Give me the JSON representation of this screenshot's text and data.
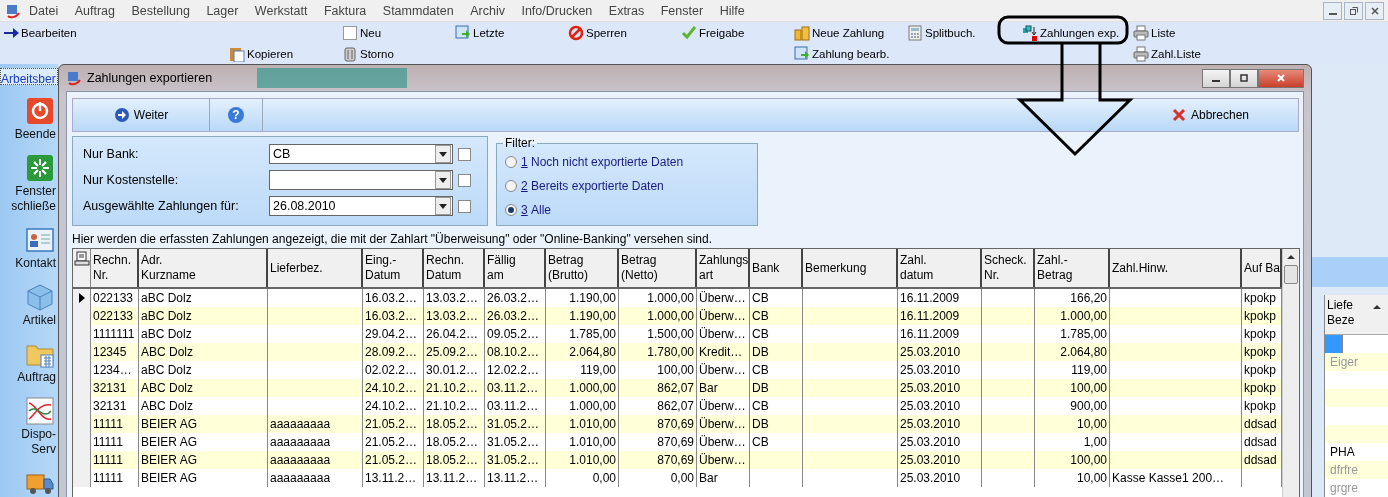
{
  "menubar": {
    "items": [
      "Datei",
      "Auftrag",
      "Bestellung",
      "Lager",
      "Werkstatt",
      "Faktura",
      "Stammdaten",
      "Archiv",
      "Info/Drucken",
      "Extras",
      "Fenster",
      "Hilfe"
    ]
  },
  "toolbar": {
    "columns": [
      {
        "top": {
          "label": "Bearbeiten",
          "highlighted": false
        }
      },
      {},
      {
        "bottom": {
          "label": "Kopieren",
          "highlighted": false
        }
      },
      {
        "top": {
          "label": "Neu",
          "highlighted": false
        },
        "bottom": {
          "label": "Storno",
          "highlighted": false
        }
      },
      {
        "top": {
          "label": "Letzte",
          "highlighted": false
        }
      },
      {
        "top": {
          "label": "Sperren",
          "highlighted": false
        }
      },
      {
        "top": {
          "label": "Freigabe",
          "highlighted": false
        }
      },
      {
        "top": {
          "label": "Neue Zahlung",
          "highlighted": false
        },
        "bottom": {
          "label": "Zahlung bearb.",
          "highlighted": false
        }
      },
      {
        "top": {
          "label": "Splitbuch.",
          "highlighted": false
        }
      },
      {
        "top": {
          "label": "Zahlungen exp.",
          "highlighted": true
        }
      },
      {
        "top": {
          "label": "Liste",
          "highlighted": false
        },
        "bottom": {
          "label": "Zahl.Liste",
          "highlighted": false
        }
      }
    ]
  },
  "sidebar": {
    "tab": "Arbeitsber",
    "items": [
      {
        "label": "Beende"
      },
      {
        "label": "Fenster schließe"
      },
      {
        "label": "Kontakt"
      },
      {
        "label": "Artikel"
      },
      {
        "label": "Auftrag"
      },
      {
        "label": "Dispo-Serv"
      }
    ]
  },
  "background_panel": {
    "header": "Liefe Beze",
    "rows": [
      {
        "selected": true
      },
      {
        "text": "Eiger",
        "selected": false,
        "dim": true
      },
      {
        "selected": false
      },
      {
        "selected": false
      },
      {
        "selected": false
      },
      {
        "selected": false
      },
      {
        "text": "PHA",
        "selected": false,
        "dim": false
      },
      {
        "text": "dfrfre",
        "selected": false,
        "dim": true
      },
      {
        "text": "grgre",
        "selected": false,
        "dim": true
      }
    ]
  },
  "dialog": {
    "title": "Zahlungen exportieren",
    "toolbar": {
      "next": "Weiter",
      "help": "?",
      "cancel": "Abbrechen"
    },
    "filters": [
      {
        "label": "Nur Bank:",
        "value": "CB",
        "checked": false
      },
      {
        "label": "Nur Kostenstelle:",
        "checked": false
      },
      {
        "label": "Ausgewählte Zahlungen für:",
        "value": "26.08.2010",
        "checked": false
      }
    ],
    "filter_group": {
      "legend": "Filter:",
      "options": [
        {
          "shortcut": "1",
          "label": "Noch nicht exportierte Daten",
          "selected": false
        },
        {
          "shortcut": "2",
          "label": "Bereits exportierte Daten",
          "selected": false
        },
        {
          "shortcut": "3",
          "label": "Alle",
          "selected": true
        }
      ]
    },
    "info": "Hier werden die erfassten Zahlungen angezeigt, die mit der Zahlart \"Überweisung\" oder \"Online-Banking\" versehen sind.",
    "table": {
      "columns": [
        {
          "lines": [
            "Rechn.",
            "Nr."
          ]
        },
        {
          "lines": [
            "Adr.",
            "Kurzname"
          ]
        },
        {
          "lines": [
            "Lieferbez."
          ]
        },
        {
          "lines": [
            "Eing.-",
            "Datum"
          ]
        },
        {
          "lines": [
            "Rechn.",
            "Datum"
          ]
        },
        {
          "lines": [
            "Fällig",
            "am"
          ]
        },
        {
          "lines": [
            "Betrag",
            "(Brutto)"
          ],
          "numeric": true
        },
        {
          "lines": [
            "Betrag",
            "(Netto)"
          ],
          "numeric": true
        },
        {
          "lines": [
            "Zahlungs",
            "art"
          ]
        },
        {
          "lines": [
            "Bank"
          ]
        },
        {
          "lines": [
            "Bemerkung"
          ]
        },
        {
          "lines": [
            "Zahl.",
            "datum"
          ]
        },
        {
          "lines": [
            "Scheck.",
            "Nr."
          ]
        },
        {
          "lines": [
            "Zahl.-",
            "Betrag"
          ],
          "numeric": true
        },
        {
          "lines": [
            "Zahl.Hinw."
          ]
        },
        {
          "lines": [
            "Auf Ba"
          ]
        }
      ],
      "rows": [
        {
          "current": true,
          "cells": [
            "022133",
            "aBC Dolz",
            null,
            "16.03.2…",
            "13.03.2…",
            "26.03.2…",
            "1.190,00",
            "1.000,00",
            "Überw…",
            "CB",
            null,
            "16.11.2009",
            null,
            "166,20",
            null,
            "kpokp"
          ]
        },
        {
          "current": false,
          "cells": [
            "022133",
            "aBC Dolz",
            null,
            "16.03.2…",
            "13.03.2…",
            "26.03.2…",
            "1.190,00",
            "1.000,00",
            "Überw…",
            "CB",
            null,
            "16.11.2009",
            null,
            "1.000,00",
            null,
            "kpokp"
          ]
        },
        {
          "current": false,
          "cells": [
            "1111111",
            "aBC Dolz",
            null,
            "29.04.2…",
            "26.04.2…",
            "09.05.2…",
            "1.785,00",
            "1.500,00",
            "Überw…",
            "CB",
            null,
            "16.11.2009",
            null,
            "1.785,00",
            null,
            "kpokp"
          ]
        },
        {
          "current": false,
          "cells": [
            "12345",
            "ABC Dolz",
            null,
            "28.09.2…",
            "25.09.2…",
            "08.10.2…",
            "2.064,80",
            "1.780,00",
            "Kredit…",
            "DB",
            null,
            "25.03.2010",
            null,
            "2.064,80",
            null,
            "kpokp"
          ]
        },
        {
          "current": false,
          "cells": [
            "1234…",
            "aBC Dolz",
            null,
            "02.02.2…",
            "30.01.2…",
            "12.02.2…",
            "119,00",
            "100,00",
            "Überw…",
            "CB",
            null,
            "25.03.2010",
            null,
            "119,00",
            null,
            "kpokp"
          ]
        },
        {
          "current": false,
          "cells": [
            "32131",
            "ABC Dolz",
            null,
            "24.10.2…",
            "21.10.2…",
            "03.11.2…",
            "1.000,00",
            "862,07",
            "Bar",
            "DB",
            null,
            "25.03.2010",
            null,
            "100,00",
            null,
            "kpokp"
          ]
        },
        {
          "current": false,
          "cells": [
            "32131",
            "ABC Dolz",
            null,
            "24.10.2…",
            "21.10.2…",
            "03.11.2…",
            "1.000,00",
            "862,07",
            "Überw…",
            "CB",
            null,
            "25.03.2010",
            null,
            "900,00",
            null,
            "kpokp"
          ]
        },
        {
          "current": false,
          "cells": [
            "11111",
            "BEIER AG",
            "aaaaaaaaa",
            "21.05.2…",
            "18.05.2…",
            "31.05.2…",
            "1.010,00",
            "870,69",
            "Überw…",
            "DB",
            null,
            "25.03.2010",
            null,
            "10,00",
            null,
            "ddsad"
          ]
        },
        {
          "current": false,
          "cells": [
            "11111",
            "BEIER AG",
            "aaaaaaaaa",
            "21.05.2…",
            "18.05.2…",
            "31.05.2…",
            "1.010,00",
            "870,69",
            "Überw…",
            "CB",
            null,
            "25.03.2010",
            null,
            "1,00",
            null,
            "ddsad"
          ]
        },
        {
          "current": false,
          "cells": [
            "11111",
            "BEIER AG",
            "aaaaaaaaa",
            "21.05.2…",
            "18.05.2…",
            "31.05.2…",
            "1.010,00",
            "870,69",
            "Überw…",
            null,
            null,
            "25.03.2010",
            null,
            "100,00",
            null,
            "ddsad"
          ]
        },
        {
          "current": false,
          "cells": [
            "11111",
            "BEIER AG",
            "aaaaaaaaa",
            "13.11.2…",
            "13.11.2…",
            "13.11.2…",
            "0,00",
            "0,00",
            "Bar",
            null,
            null,
            "25.03.2010",
            null,
            "10,00",
            "Kasse Kasse1 200…",
            null
          ]
        }
      ]
    }
  }
}
